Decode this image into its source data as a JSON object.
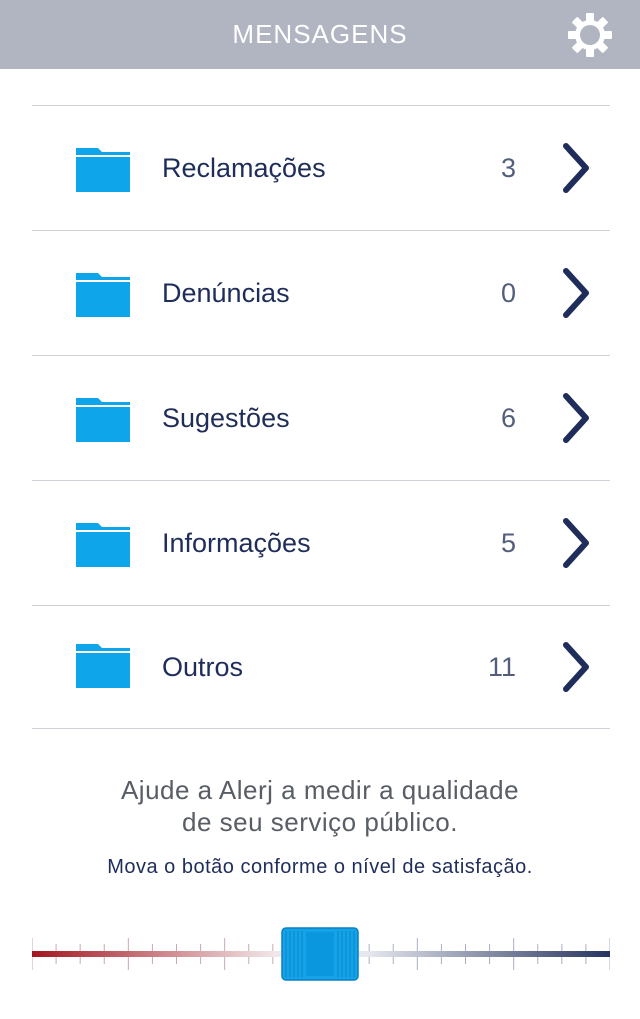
{
  "header": {
    "title": "MENSAGENS",
    "settings_icon": "gear-icon",
    "background": "#b0b5c1"
  },
  "categories": [
    {
      "label": "Reclamações",
      "count": "3",
      "icon": "folder-icon"
    },
    {
      "label": "Denúncias",
      "count": "0",
      "icon": "folder-icon"
    },
    {
      "label": "Sugestões",
      "count": "6",
      "icon": "folder-icon"
    },
    {
      "label": "Informações",
      "count": "5",
      "icon": "folder-icon"
    },
    {
      "label": "Outros",
      "count": "11",
      "icon": "folder-icon"
    }
  ],
  "survey": {
    "title_line1": "Ajude a Alerj a medir a qualidade",
    "title_line2": "de seu serviço público.",
    "hint": "Mova o botão conforme o nível de satisfação.",
    "slider_value": 0.5
  },
  "colors": {
    "folder": "#0ea5ea",
    "text_dark": "#1f2d5a",
    "count": "#535e7c",
    "slider_red": "#a31520",
    "slider_blue": "#26335e",
    "slider_handle": "#14a3e8"
  }
}
